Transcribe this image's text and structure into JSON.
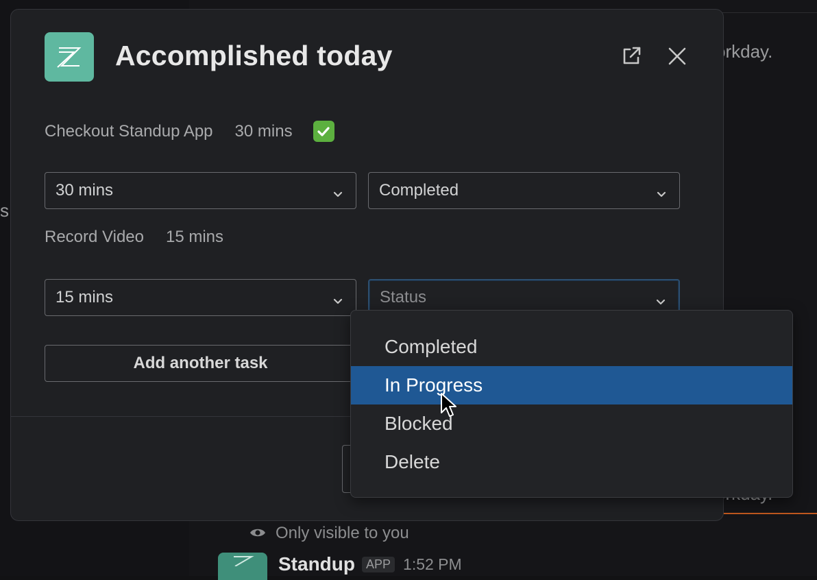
{
  "background": {
    "text_top": "orkday.",
    "text_bottom": "orkday.",
    "edge_letter": "s",
    "visibility_note": "Only visible to you",
    "app_name": "Standup",
    "app_badge": "APP",
    "timestamp": "1:52 PM"
  },
  "modal": {
    "title": "Accomplished today",
    "icons": {
      "app": "zapier-z-icon",
      "external": "external-link-icon",
      "close": "close-icon"
    },
    "tasks": [
      {
        "name": "Checkout Standup App",
        "duration": "30 mins",
        "status_emoji": "✅",
        "duration_select": "30 mins",
        "status_select": "Completed"
      },
      {
        "name": "Record Video",
        "duration": "15 mins",
        "duration_select": "15 mins",
        "status_placeholder": "Status"
      }
    ],
    "add_task_label": "Add another task"
  },
  "dropdown": {
    "options": [
      "Completed",
      "In Progress",
      "Blocked",
      "Delete"
    ],
    "highlighted": "In Progress"
  },
  "colors": {
    "accent_highlight": "#1f5894",
    "app_icon": "#5fb8a0",
    "check_green": "#5cb03f"
  }
}
